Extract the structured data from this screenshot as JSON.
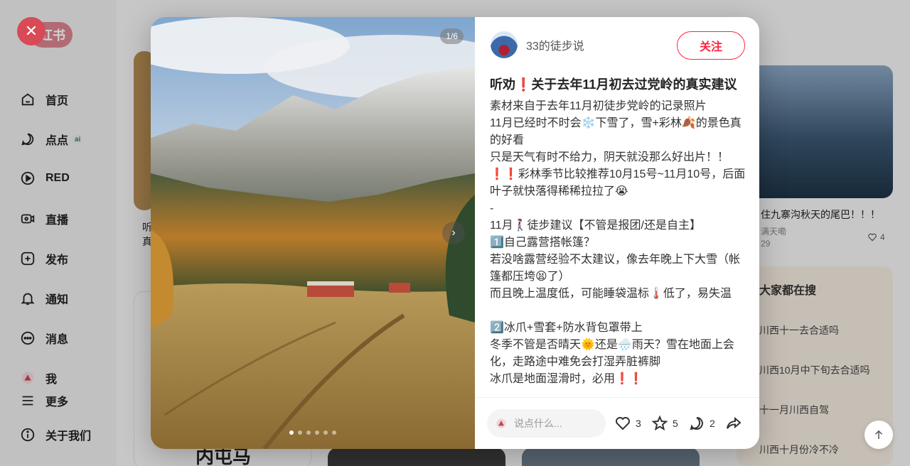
{
  "app": {
    "logo_text": "红书"
  },
  "sidebar": {
    "items": [
      {
        "label": "首页",
        "icon": "home-icon"
      },
      {
        "label": "点点",
        "badge": "ai",
        "icon": "chat-bubble-icon"
      },
      {
        "label": "RED",
        "icon": "play-icon"
      },
      {
        "label": "直播",
        "icon": "live-icon"
      },
      {
        "label": "发布",
        "icon": "plus-icon"
      },
      {
        "label": "通知",
        "icon": "bell-icon"
      },
      {
        "label": "消息",
        "icon": "message-icon"
      },
      {
        "label": "我",
        "icon": "user-avatar-icon"
      },
      {
        "label": "更多",
        "icon": "menu-icon"
      },
      {
        "label": "关于我们",
        "icon": "info-icon"
      }
    ]
  },
  "feed": {
    "left_card_text": "听",
    "left_card_text2": "真",
    "right_card_title": "住九寨沟秋天的尾巴！！！",
    "right_card_author": "满天嘞",
    "right_card_date": "29",
    "right_card_likes": "4",
    "search_title": "大家都在搜",
    "search_items": [
      "川西十一去合适吗",
      "川西10月中下旬去合适吗",
      "十一月川西自驾",
      "川西十月份冷不冷"
    ],
    "bottom_card_text": "内屯马"
  },
  "modal": {
    "image_counter": "1/6",
    "dots_total": 6,
    "dots_active": 0,
    "author_name": "33的徒步说",
    "follow_label": "关注",
    "title": "听劝❗️关于去年11月初去过党岭的真实建议",
    "body_lines": [
      "素材来自于去年11月初徒步党岭的记录照片",
      "11月已经时不时会❄️下雪了，雪+彩林🍂的景色真的好看",
      "只是天气有时不给力，阴天就没那么好出片！！",
      "❗️❗️彩林季节比较推荐10月15号~11月10号，后面叶子就快落得稀稀拉拉了😭",
      "-",
      "11月🚶‍♀️徒步建议【不管是报团/还是自主】",
      "1️⃣自己露营搭帐篷？",
      "若没啥露营经验不太建议，像去年晚上下大雪（帐篷都压垮😫了）",
      "而且晚上温度低，可能睡袋温标🌡️低了，易失温",
      "",
      "2️⃣冰爪+雪套+防水背包罩带上",
      "冬季不管是否晴天🌞还是🌧️雨天？雪在地面上会化，走路途中难免会打湿弄脏裤脚",
      "冰爪是地面湿滑时，必用❗️❗️"
    ],
    "comment_placeholder": "说点什么...",
    "likes": "3",
    "collects": "5",
    "comments": "2"
  },
  "colors": {
    "brand": "#ff2442"
  }
}
